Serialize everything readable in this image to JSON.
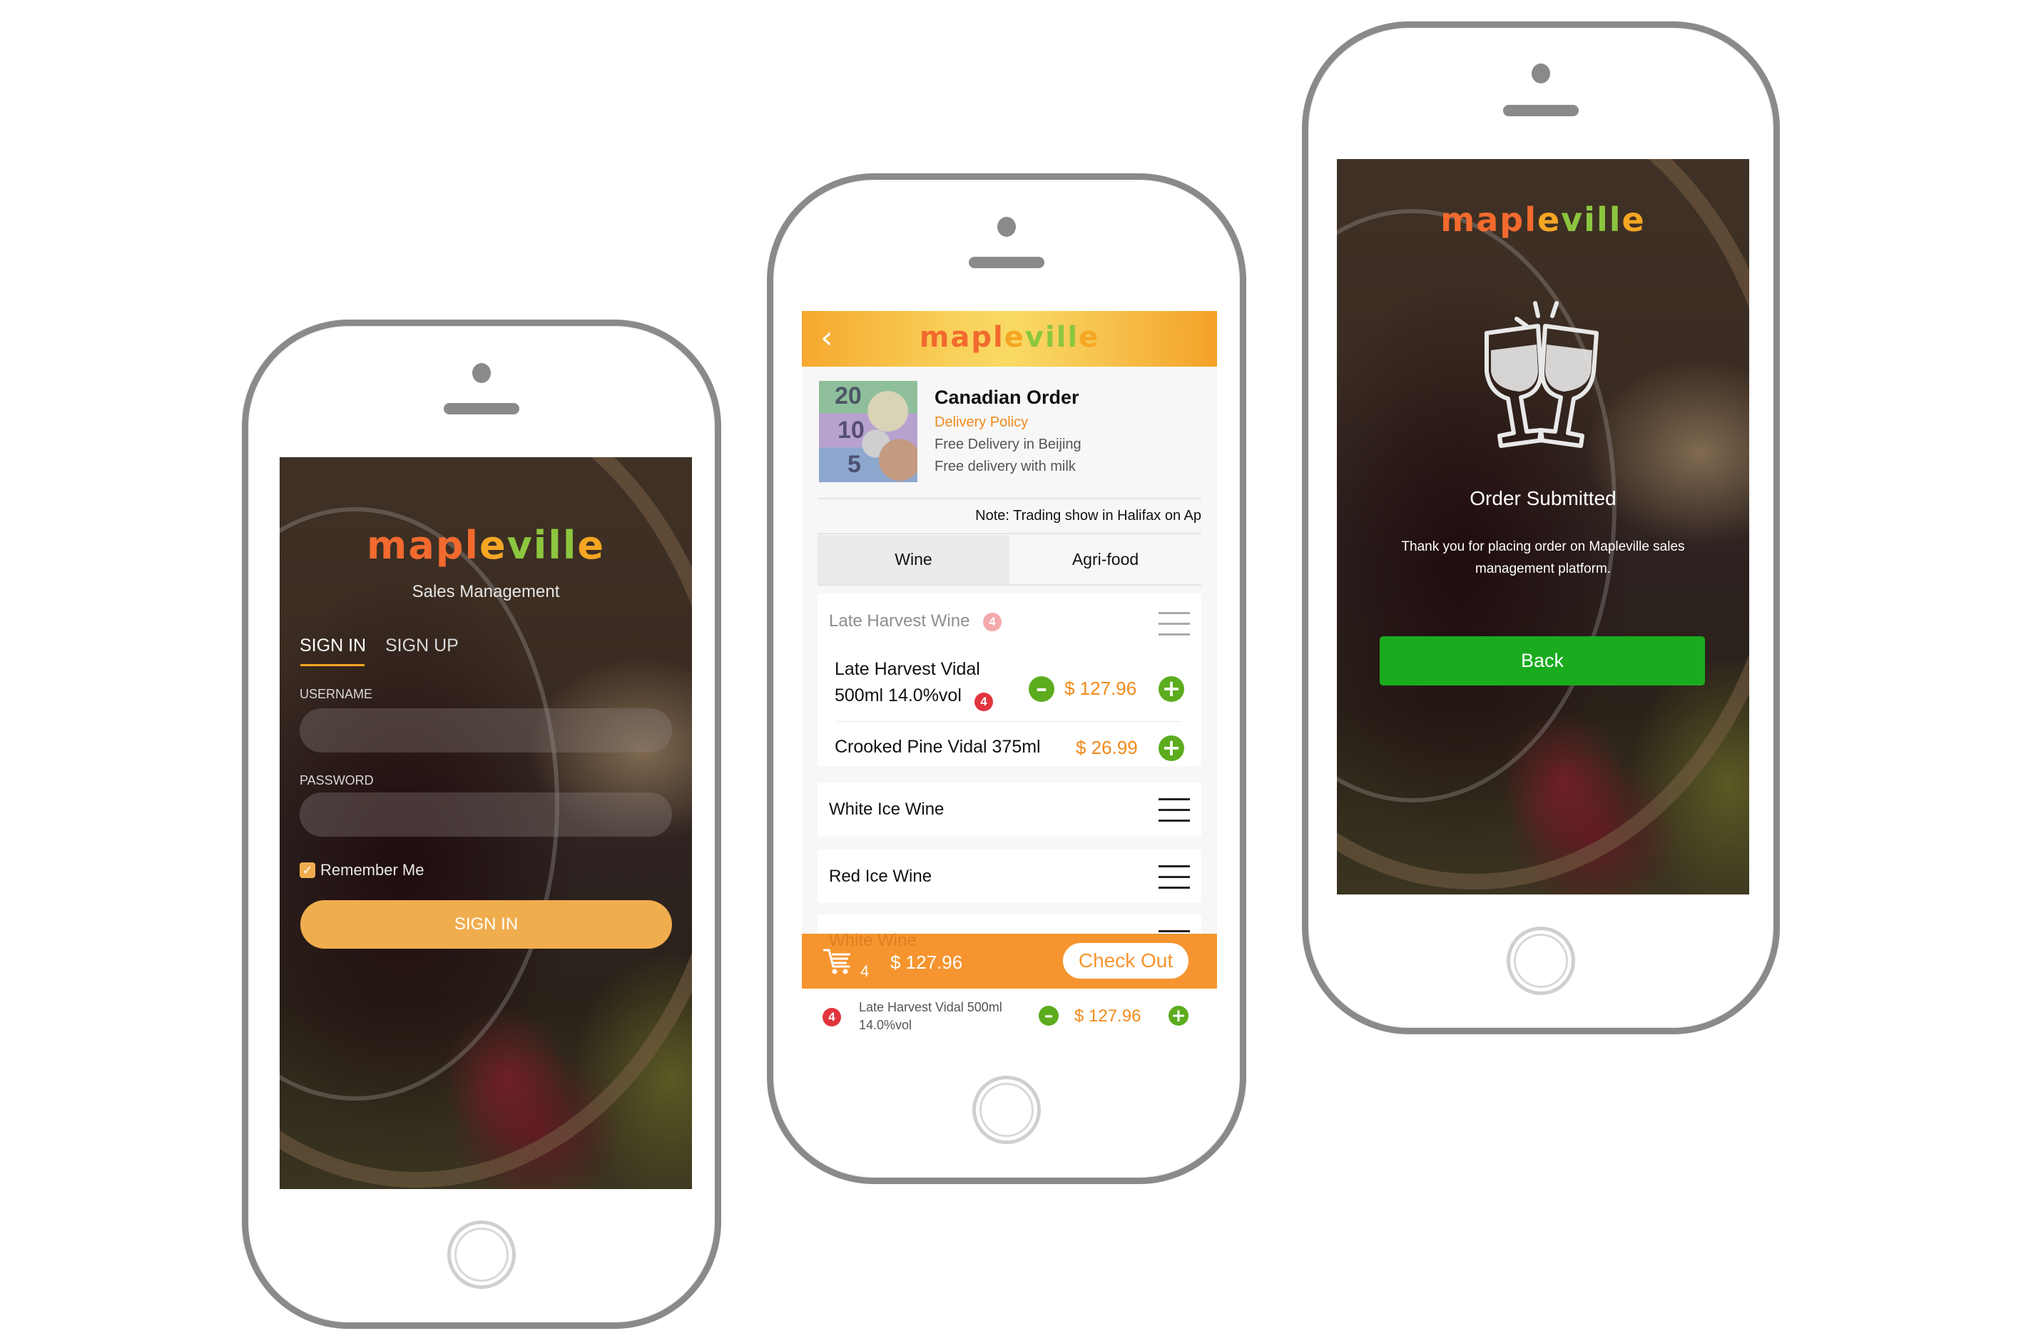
{
  "brand": {
    "logo_parts": [
      {
        "text": "m",
        "color": "#f26a2e"
      },
      {
        "text": "a",
        "color": "#f26a2e"
      },
      {
        "text": "p",
        "color": "#f26a2e"
      },
      {
        "text": "l",
        "color": "#f26a2e"
      },
      {
        "text": "e",
        "color": "#f5a623"
      },
      {
        "text": "v",
        "color": "#8cc63f"
      },
      {
        "text": "i",
        "color": "#8cc63f"
      },
      {
        "text": "l",
        "color": "#8cc63f"
      },
      {
        "text": "l",
        "color": "#8cc63f"
      },
      {
        "text": "e",
        "color": "#f5a623"
      }
    ],
    "colors": {
      "accent_orange": "#f0ad4e",
      "cart_orange": "#f6952f",
      "price_orange": "#f28a1a",
      "green": "#5cac1e",
      "back_green": "#1aab1f",
      "badge_red": "#e2343d"
    }
  },
  "login_screen": {
    "subtitle": "Sales Management",
    "tabs": [
      {
        "label": "SIGN IN",
        "active": true
      },
      {
        "label": "SIGN UP",
        "active": false
      }
    ],
    "username_label": "USERNAME",
    "username_value": "",
    "password_label": "PASSWORD",
    "password_value": "",
    "remember_me": {
      "label": "Remember Me",
      "checked": true
    },
    "submit_label": "SIGN IN"
  },
  "order_screen": {
    "header": {
      "back_icon": "chevron-left-icon"
    },
    "store": {
      "title": "Canadian Order",
      "policy_link": "Delivery Policy",
      "policy_lines": [
        "Free Delivery in Beijing",
        "Free delivery with milk"
      ],
      "image_alt": "Canadian currency",
      "image_numbers": [
        "20",
        "10",
        "5"
      ]
    },
    "note": "Note: Trading show in Halifax on Ap",
    "tabs": [
      {
        "label": "Wine",
        "active": true
      },
      {
        "label": "Agri-food",
        "active": false
      }
    ],
    "categories": [
      {
        "name": "Late Harvest Wine",
        "badge": "4",
        "expanded": true,
        "items": [
          {
            "name_line1": "Late Harvest Vidal",
            "name_line2": "500ml 14.0%vol",
            "qty": "4",
            "price": "$ 127.96"
          },
          {
            "name_line1": "Crooked Pine Vidal 375ml",
            "price": "$ 26.99"
          }
        ]
      },
      {
        "name": "White Ice Wine"
      },
      {
        "name": "Red Ice Wine"
      },
      {
        "name": "White Wine"
      }
    ],
    "cart": {
      "count": "4",
      "total": "$ 127.96",
      "checkout_label": "Check Out"
    },
    "cart_items": [
      {
        "qty": "4",
        "name_line1": "Late Harvest Vidal 500ml",
        "name_line2": "14.0%vol",
        "price": "$ 127.96"
      }
    ]
  },
  "confirm_screen": {
    "title": "Order Submitted",
    "message": "Thank you for placing order on Mapleville sales management platform.",
    "back_label": "Back"
  }
}
